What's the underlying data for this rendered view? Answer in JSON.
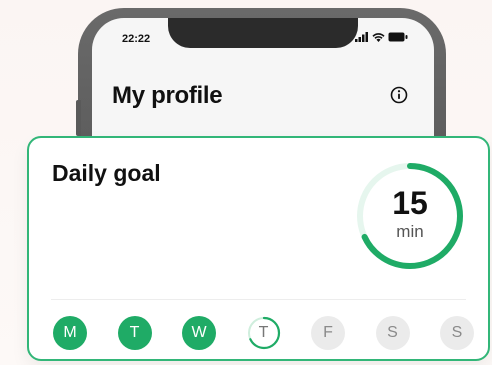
{
  "status_bar": {
    "time": "22:22"
  },
  "profile": {
    "title": "My profile"
  },
  "daily_goal": {
    "title": "Daily goal",
    "value": "15",
    "unit": "min",
    "progress": 0.68,
    "accent": "#1fab66"
  },
  "week": [
    {
      "label": "M",
      "state": "done"
    },
    {
      "label": "T",
      "state": "done"
    },
    {
      "label": "W",
      "state": "done"
    },
    {
      "label": "T",
      "state": "today"
    },
    {
      "label": "F",
      "state": "future"
    },
    {
      "label": "S",
      "state": "future"
    },
    {
      "label": "S",
      "state": "future"
    }
  ]
}
